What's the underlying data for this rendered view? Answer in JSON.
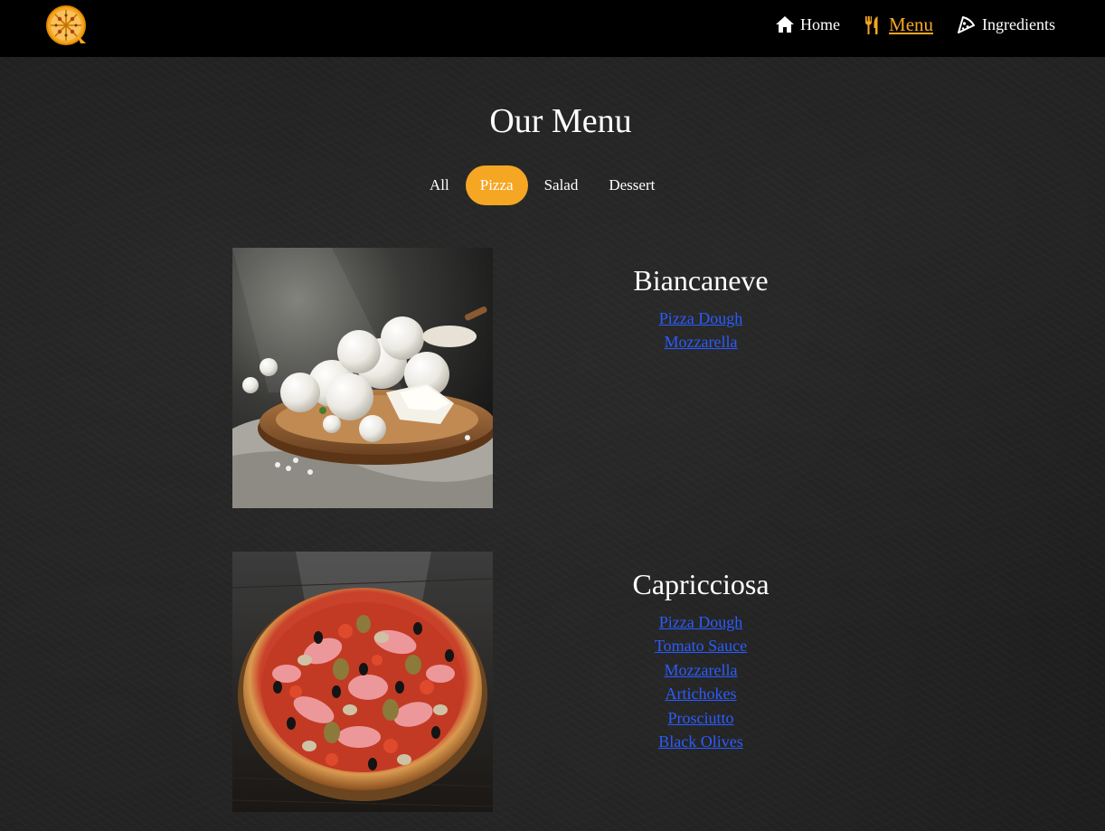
{
  "nav": {
    "items": [
      {
        "label": "Home",
        "icon": "home-icon"
      },
      {
        "label": "Menu",
        "icon": "utensils-icon"
      },
      {
        "label": "Ingredients",
        "icon": "pizza-slice-icon"
      }
    ]
  },
  "page": {
    "title": "Our Menu"
  },
  "tabs": [
    {
      "label": "All"
    },
    {
      "label": "Pizza"
    },
    {
      "label": "Salad"
    },
    {
      "label": "Dessert"
    }
  ],
  "menu_items": [
    {
      "name": "Biancaneve",
      "ingredients": [
        "Pizza Dough",
        "Mozzarella"
      ]
    },
    {
      "name": "Capricciosa",
      "ingredients": [
        "Pizza Dough",
        "Tomato Sauce",
        "Mozzarella",
        "Artichokes",
        "Prosciutto",
        "Black Olives"
      ]
    }
  ],
  "colors": {
    "accent": "#f5a623",
    "link": "#2b5cff",
    "navbar": "#000000",
    "background": "#1d1d1d"
  }
}
